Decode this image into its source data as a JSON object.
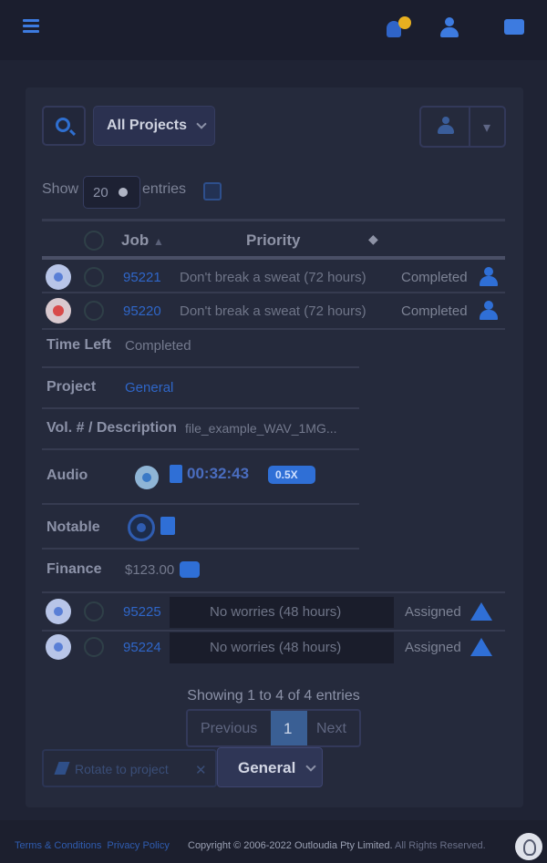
{
  "toolbar": {
    "project_select": "All Projects",
    "show_label": "Show",
    "entries_value": "20",
    "entries_label": "entries"
  },
  "table": {
    "headers": {
      "job": "Job",
      "priority": "Priority"
    },
    "rows": [
      {
        "job": "95221",
        "priority": "Don't break a sweat (72 hours)",
        "status": "Completed",
        "expander": "blue"
      },
      {
        "job": "95220",
        "priority": "Don't break a sweat (72 hours)",
        "status": "Completed",
        "expander": "red"
      },
      {
        "job": "95225",
        "priority": "No worries (48 hours)",
        "status": "Assigned",
        "expander": "blue"
      },
      {
        "job": "95224",
        "priority": "No worries (48 hours)",
        "status": "Assigned",
        "expander": "blue"
      }
    ]
  },
  "details": {
    "time_left_label": "Time Left",
    "time_left_value": "Completed",
    "project_label": "Project",
    "project_value": "General",
    "vol_label": "Vol. # / Description",
    "vol_value": "file_example_WAV_1MG...",
    "audio_label": "Audio",
    "audio_time": "00:32:43",
    "audio_speed": "0.5X",
    "notable_label": "Notable",
    "finance_label": "Finance",
    "finance_value": "$123.00"
  },
  "pagination": {
    "summary": "Showing 1 to 4 of 4 entries",
    "prev": "Previous",
    "current": "1",
    "next": "Next"
  },
  "actions": {
    "rotate_label": "Rotate to project",
    "project_select": "General"
  },
  "footer": {
    "terms": "Terms & Conditions",
    "privacy": "Privacy Policy",
    "copyright": "Copyright © 2006-2022 Outloudia Pty Limited.",
    "rights": "All Rights Reserved."
  },
  "colors": {
    "accent": "#2f6fd6",
    "background": "#1f2334",
    "card": "#252a3c",
    "notification": "#e8b020",
    "danger": "#d84a4a"
  },
  "icons": [
    "menu-icon",
    "bell-icon",
    "user-icon",
    "mail-icon",
    "search-icon",
    "add-user-icon",
    "calendar-icon",
    "play-icon",
    "file-icon",
    "pen-icon",
    "help-icon"
  ]
}
